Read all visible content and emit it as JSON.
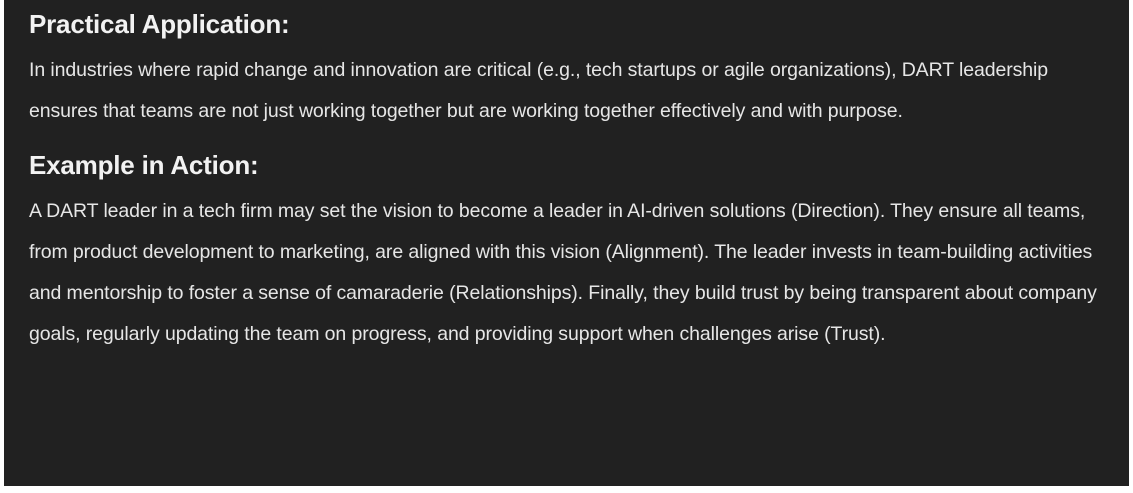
{
  "sections": [
    {
      "heading": "Practical Application:",
      "paragraph": "In industries where rapid change and innovation are critical (e.g., tech startups or agile organizations), DART leadership ensures that teams are not just working together but are working together effectively and with purpose."
    },
    {
      "heading": "Example in Action:",
      "paragraph": "A DART leader in a tech firm may set the vision to become a leader in AI-driven solutions (Direction). They ensure all teams, from product development to marketing, are aligned with this vision (Alignment). The leader invests in team-building activities and mentorship to foster a sense of camaraderie (Relationships). Finally, they build trust by being transparent about company goals, regularly updating the team on progress, and providing support when challenges arise (Trust)."
    }
  ],
  "colors": {
    "background": "#212121",
    "text": "#ececec",
    "page": "#ffffff"
  }
}
